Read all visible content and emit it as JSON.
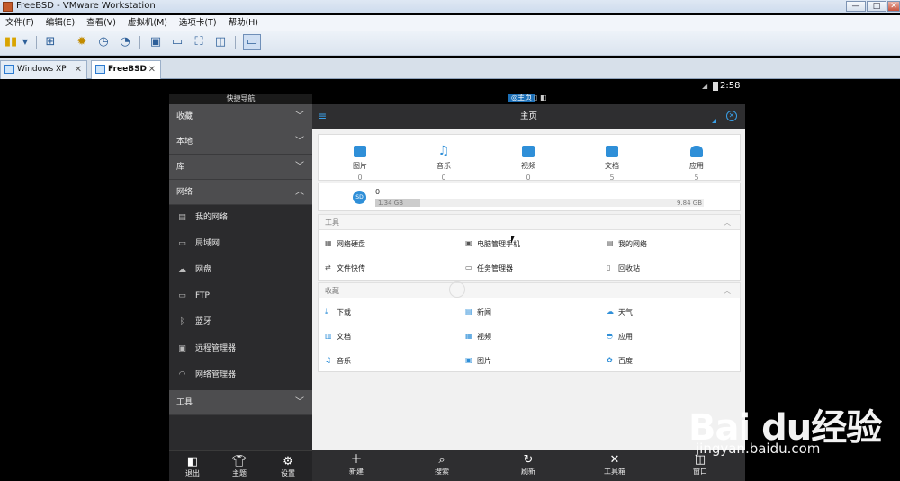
{
  "window": {
    "title": "FreeBSD - VMware Workstation",
    "min": "—",
    "max": "□",
    "close": "✕"
  },
  "menu": [
    "文件(F)",
    "编辑(E)",
    "查看(V)",
    "虚拟机(M)",
    "选项卡(T)",
    "帮助(H)"
  ],
  "tabs": [
    {
      "label": "Windows XP",
      "close": "✕"
    },
    {
      "label": "FreeBSD",
      "close": "✕"
    }
  ],
  "status": {
    "clock": "2:58",
    "home_tab": "◎主页"
  },
  "sidebar": {
    "title": "快捷导航",
    "sections": {
      "favorites": "收藏",
      "local": "本地",
      "library": "库",
      "network": "网络",
      "tools": "工具"
    },
    "network_items": [
      "我的网络",
      "局域网",
      "网盘",
      "FTP",
      "蓝牙",
      "远程管理器",
      "网络管理器"
    ],
    "bottom": [
      "退出",
      "主题",
      "设置"
    ]
  },
  "main": {
    "title": "主页",
    "categories": [
      {
        "label": "图片",
        "count": "0"
      },
      {
        "label": "音乐",
        "count": "0"
      },
      {
        "label": "视频",
        "count": "0"
      },
      {
        "label": "文档",
        "count": "5"
      },
      {
        "label": "应用",
        "count": "5"
      }
    ],
    "storage": {
      "badge": "SD",
      "name": "0",
      "used": "1.34 GB",
      "total": "9.84 GB",
      "fraction": 0.136
    },
    "tools_header": "工具",
    "tools_items": [
      "网络硬盘",
      "电脑管理手机",
      "我的网络",
      "文件快传",
      "任务管理器",
      "回收站"
    ],
    "fav_header": "收藏",
    "fav_items": [
      "下载",
      "新闻",
      "天气",
      "文档",
      "视频",
      "应用",
      "音乐",
      "图片",
      "百度"
    ],
    "bottom": [
      "新建",
      "搜索",
      "刷新",
      "工具箱",
      "窗口"
    ]
  },
  "watermark": {
    "main": "Bai du经验",
    "sub": "jingyan.baidu.com"
  },
  "colors": {
    "accent": "#2f8fd8",
    "sidebar": "#2b2b2d",
    "section": "#4d4d4f"
  }
}
